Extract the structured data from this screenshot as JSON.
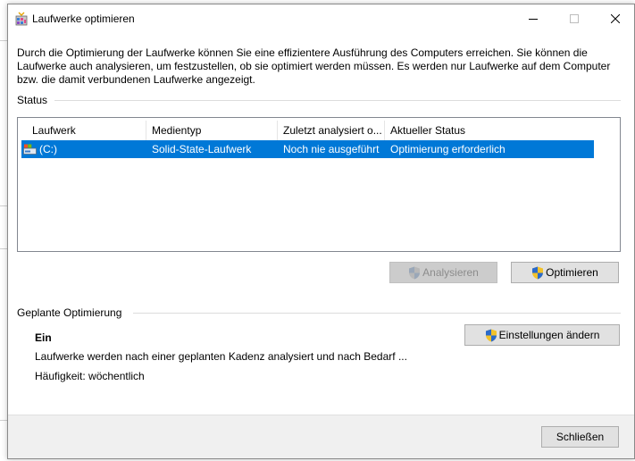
{
  "window": {
    "title": "Laufwerke optimieren",
    "minimize_icon": "minimize-icon",
    "maximize_icon": "maximize-icon",
    "close_icon": "close-icon"
  },
  "description": "Durch die Optimierung der Laufwerke können Sie eine effizientere Ausführung des Computers erreichen. Sie können die Laufwerke auch analysieren, um festzustellen, ob sie optimiert werden müssen. Es werden nur Laufwerke auf dem Computer bzw. die damit verbundenen Laufwerke angezeigt.",
  "status": {
    "label": "Status",
    "columns": [
      "Laufwerk",
      "Medientyp",
      "Zuletzt analysiert o...",
      "Aktueller Status"
    ],
    "rows": [
      {
        "drive": "(C:)",
        "media_type": "Solid-State-Laufwerk",
        "last_analyzed": "Noch nie ausgeführt",
        "current_status": "Optimierung erforderlich",
        "selected": true
      }
    ],
    "analyze_button": "Analysieren",
    "optimize_button": "Optimieren"
  },
  "scheduled": {
    "label": "Geplante Optimierung",
    "state": "Ein",
    "description": "Laufwerke werden nach einer geplanten Kadenz analysiert und nach Bedarf ...",
    "frequency": "Häufigkeit: wöchentlich",
    "change_settings_button": "Einstellungen ändern"
  },
  "footer": {
    "close_button": "Schließen"
  },
  "colors": {
    "selection": "#0078d7",
    "button_face": "#e1e1e1",
    "footer_bg": "#f0f0f0"
  }
}
